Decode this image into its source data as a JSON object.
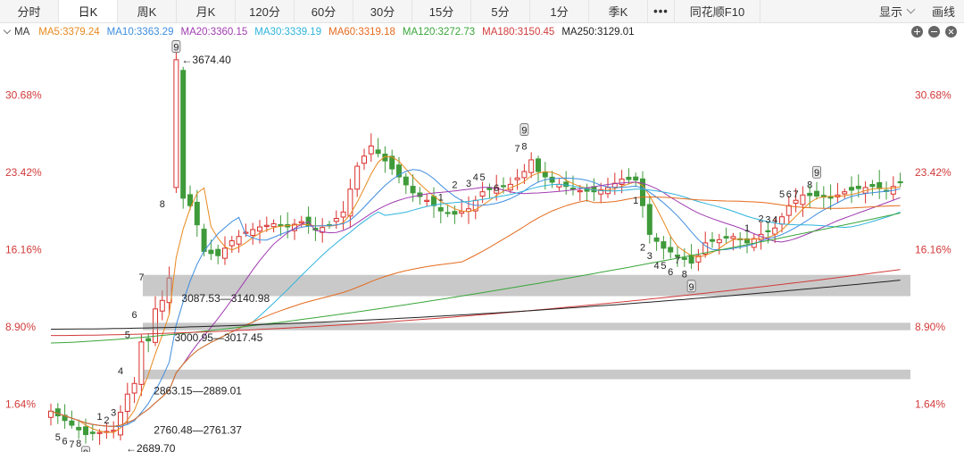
{
  "tabs": [
    {
      "label": "分时",
      "active": false
    },
    {
      "label": "日K",
      "active": true
    },
    {
      "label": "周K",
      "active": false
    },
    {
      "label": "月K",
      "active": false
    },
    {
      "label": "120分",
      "active": false
    },
    {
      "label": "60分",
      "active": false
    },
    {
      "label": "30分",
      "active": false
    },
    {
      "label": "15分",
      "active": false
    },
    {
      "label": "5分",
      "active": false
    },
    {
      "label": "1分",
      "active": false
    },
    {
      "label": "季K",
      "active": false
    }
  ],
  "more_label": "•••",
  "f10_label": "同花顺F10",
  "display_label": "显示",
  "draw_label": "画线",
  "ma_bar": {
    "name": "MA",
    "items": [
      {
        "label": "MA5:3379.24",
        "color": "#e8891e"
      },
      {
        "label": "MA10:3363.29",
        "color": "#3d8de0"
      },
      {
        "label": "MA20:3360.15",
        "color": "#a03cb0"
      },
      {
        "label": "MA30:3339.19",
        "color": "#2eb3dc"
      },
      {
        "label": "MA60:3319.18",
        "color": "#e56b1e"
      },
      {
        "label": "MA120:3272.73",
        "color": "#3aa53a"
      },
      {
        "label": "MA180:3150.45",
        "color": "#d23b3b"
      },
      {
        "label": "MA250:3129.01",
        "color": "#222222"
      }
    ]
  },
  "chart_data": {
    "type": "candlestick",
    "y_axis_labels": [
      "30.68%",
      "23.42%",
      "16.16%",
      "8.90%",
      "1.64%"
    ],
    "y_axis_values": [
      30.68,
      23.42,
      16.16,
      8.9,
      1.64
    ],
    "ylim": [
      -2.5,
      35.5
    ],
    "grid": false,
    "colors": {
      "up": "#d9302c",
      "down": "#3f9a3a"
    },
    "annotations": [
      {
        "text": "←3674.40",
        "bar": 18,
        "value": 34.0
      },
      {
        "text": "3087.53—3140.98",
        "bar": 18,
        "value": 11.6
      },
      {
        "text": "3000.95—3017.45",
        "bar": 17,
        "value": 7.9
      },
      {
        "text": "2863.15—2889.01",
        "bar": 14,
        "value": 2.9
      },
      {
        "text": "2760.48—2761.37",
        "bar": 14,
        "value": -0.8
      },
      {
        "text": "←2689.70",
        "bar": 10,
        "value": -2.5
      }
    ],
    "price_zones": [
      {
        "low": 11.8,
        "high": 13.8
      },
      {
        "low": 8.6,
        "high": 9.3
      },
      {
        "low": 4.0,
        "high": 4.9
      }
    ],
    "sequence_labels": [
      {
        "text": "5",
        "bar": 1,
        "value": -1.4
      },
      {
        "text": "6",
        "bar": 2,
        "value": -1.8
      },
      {
        "text": "7",
        "bar": 3,
        "value": -2.1
      },
      {
        "text": "8",
        "bar": 4,
        "value": -2.0
      },
      {
        "text": "9",
        "bar": 5,
        "value": -2.9,
        "boxed": true
      },
      {
        "text": "1",
        "bar": 7,
        "value": 0.5
      },
      {
        "text": "2",
        "bar": 8,
        "value": 0.2
      },
      {
        "text": "3",
        "bar": 9,
        "value": 0.9
      },
      {
        "text": "4",
        "bar": 10,
        "value": 4.8
      },
      {
        "text": "5",
        "bar": 11,
        "value": 8.2
      },
      {
        "text": "6",
        "bar": 12,
        "value": 10.1
      },
      {
        "text": "7",
        "bar": 13,
        "value": 13.6
      },
      {
        "text": "8",
        "bar": 16,
        "value": 20.5
      },
      {
        "text": "9",
        "bar": 18,
        "value": 35.2,
        "boxed": true
      },
      {
        "text": "1",
        "bar": 56,
        "value": 21.1
      },
      {
        "text": "2",
        "bar": 58,
        "value": 22.3
      },
      {
        "text": "3",
        "bar": 60,
        "value": 22.4
      },
      {
        "text": "4",
        "bar": 61,
        "value": 23.0
      },
      {
        "text": "5",
        "bar": 62,
        "value": 23.0
      },
      {
        "text": "6",
        "bar": 64,
        "value": 22.0
      },
      {
        "text": "7",
        "bar": 67,
        "value": 25.7
      },
      {
        "text": "8",
        "bar": 68,
        "value": 25.9
      },
      {
        "text": "9",
        "bar": 68,
        "value": 27.4,
        "boxed": true
      },
      {
        "text": "1",
        "bar": 84,
        "value": 20.8
      },
      {
        "text": "2",
        "bar": 85,
        "value": 16.4
      },
      {
        "text": "3",
        "bar": 86,
        "value": 15.6
      },
      {
        "text": "4",
        "bar": 87,
        "value": 14.7
      },
      {
        "text": "5",
        "bar": 88,
        "value": 14.7
      },
      {
        "text": "6",
        "bar": 89,
        "value": 14.1
      },
      {
        "text": "7",
        "bar": 90,
        "value": 15.2
      },
      {
        "text": "8",
        "bar": 91,
        "value": 13.9
      },
      {
        "text": "9",
        "bar": 92,
        "value": 12.7,
        "boxed": true
      },
      {
        "text": "1",
        "bar": 100,
        "value": 18.2
      },
      {
        "text": "2",
        "bar": 102,
        "value": 19.1
      },
      {
        "text": "3",
        "bar": 103,
        "value": 19.0
      },
      {
        "text": "4",
        "bar": 104,
        "value": 19.0
      },
      {
        "text": "5",
        "bar": 105,
        "value": 21.4
      },
      {
        "text": "6",
        "bar": 106,
        "value": 21.4
      },
      {
        "text": "7",
        "bar": 107,
        "value": 21.4
      },
      {
        "text": "8",
        "bar": 109,
        "value": 22.3
      },
      {
        "text": "9",
        "bar": 110,
        "value": 23.4,
        "boxed": true
      }
    ]
  }
}
